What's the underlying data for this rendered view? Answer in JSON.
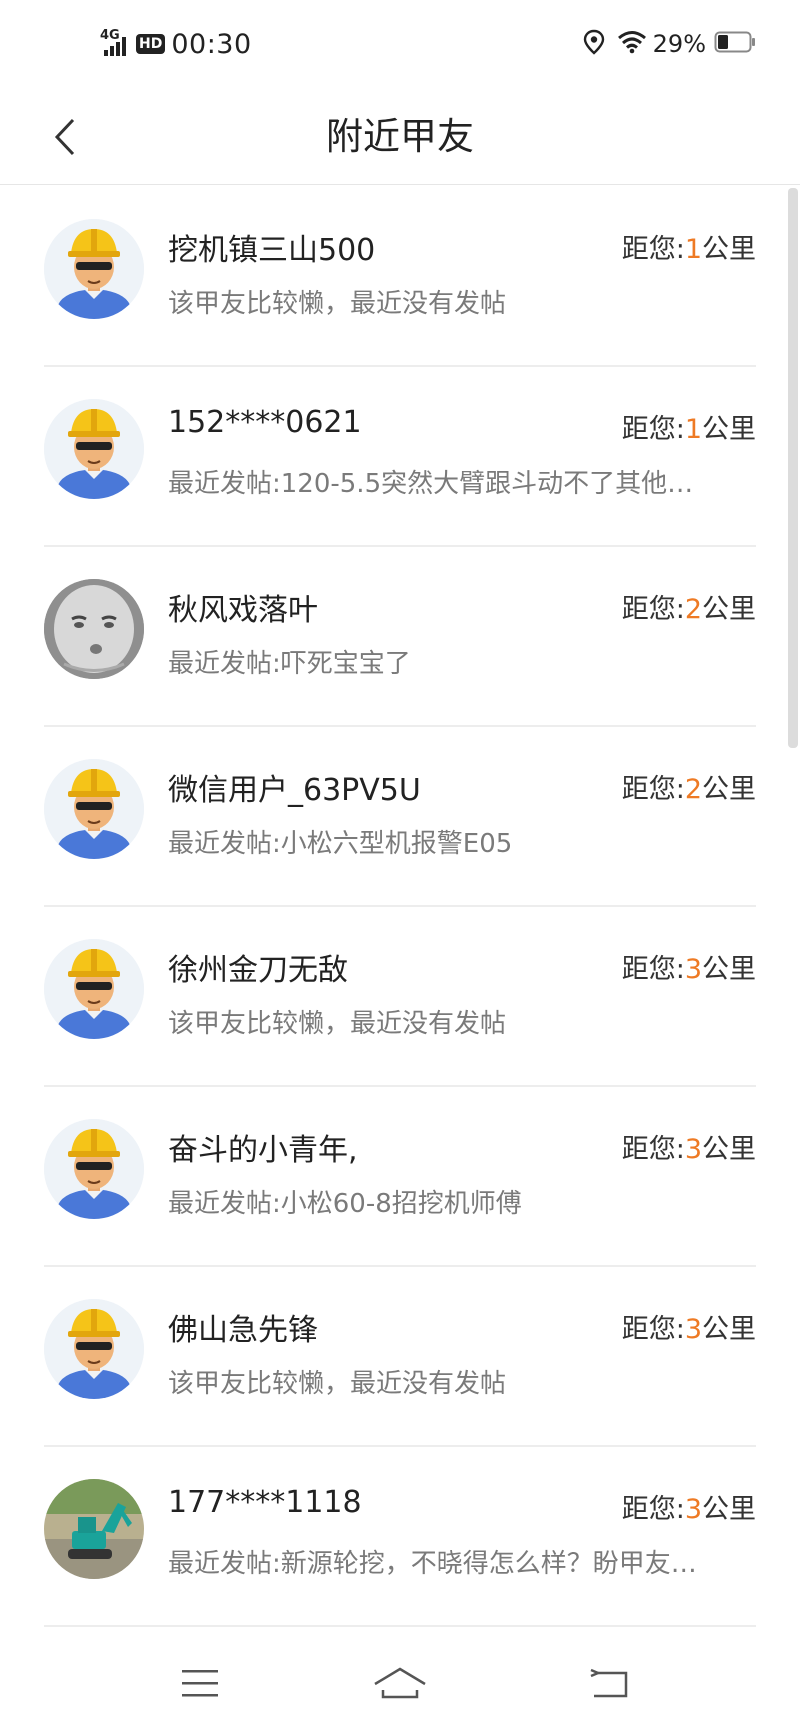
{
  "status_bar": {
    "network": "4G",
    "hd": "HD",
    "time": "00:30",
    "battery": "29%"
  },
  "header": {
    "title": "附近甲友"
  },
  "distance": {
    "prefix": "距您:",
    "unit": "公里"
  },
  "users": [
    {
      "name": "挖机镇三山500",
      "post": "该甲友比较懒，最近没有发帖",
      "km": "1",
      "avatar": "worker-avatar"
    },
    {
      "name": "152****0621",
      "post": "最近发帖:120-5.5突然大臂跟斗动不了其他…",
      "km": "1",
      "avatar": "worker-avatar"
    },
    {
      "name": "秋风戏落叶",
      "post": "最近发帖:吓死宝宝了",
      "km": "2",
      "avatar": "meme-face-avatar"
    },
    {
      "name": "微信用户_63PV5U",
      "post": "最近发帖:小松六型机报警E05",
      "km": "2",
      "avatar": "worker-avatar"
    },
    {
      "name": "徐州金刀无敌",
      "post": "该甲友比较懒，最近没有发帖",
      "km": "3",
      "avatar": "worker-avatar"
    },
    {
      "name": "奋斗的小青年,",
      "post": "最近发帖:小松60-8招挖机师傅",
      "km": "3",
      "avatar": "worker-avatar"
    },
    {
      "name": "佛山急先锋",
      "post": "该甲友比较懒，最近没有发帖",
      "km": "3",
      "avatar": "worker-avatar"
    },
    {
      "name": "177****1118",
      "post": "最近发帖:新源轮挖，不晓得怎么样？盼甲友…",
      "km": "3",
      "avatar": "excavator-photo-avatar"
    }
  ],
  "colors": {
    "accent": "#ee7a24",
    "text": "#222222",
    "subtext": "#7a7a7a",
    "divider": "#ededed"
  },
  "nav": {
    "icons": [
      "menu-icon",
      "home-icon",
      "back-icon"
    ]
  }
}
